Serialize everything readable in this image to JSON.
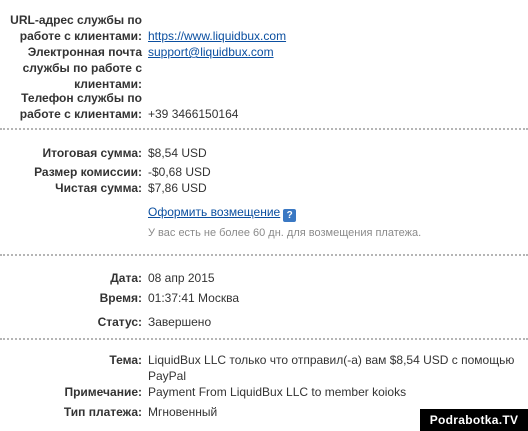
{
  "support": {
    "url_label_1": "URL-адрес службы по",
    "url_label_2": "работе с клиентами:",
    "url_value": "https://www.liquidbux.com",
    "email_label_1": "Электронная почта",
    "email_label_2": "службы по работе с",
    "email_label_3": "клиентами:",
    "email_value": "support@liquidbux.com",
    "phone_label_1": "Телефон службы по",
    "phone_label_2": "работе с клиентами:",
    "phone_value": "+39 3466150164"
  },
  "amounts": {
    "total_label": "Итоговая сумма:",
    "total_value": "$8,54 USD",
    "fee_label": "Размер комиссии:",
    "fee_value": "-$0,68 USD",
    "net_label": "Чистая сумма:",
    "net_value": "$7,86 USD",
    "refund_link": "Оформить возмещение",
    "help_icon_glyph": "?",
    "refund_note": "У вас есть не более 60 дн. для возмещения платежа."
  },
  "datetime": {
    "date_label": "Дата:",
    "date_value": "08 апр 2015",
    "time_label": "Время:",
    "time_value": "01:37:41 Москва",
    "status_label": "Статус:",
    "status_value": "Завершено"
  },
  "details": {
    "subject_label": "Тема:",
    "subject_line_1": "LiquidBux LLC только что отправил(-а) вам $8,54 USD с помощью",
    "subject_line_2": "PayPal",
    "note_label": "Примечание:",
    "note_value": "Payment From LiquidBux LLC to member koioks",
    "type_label": "Тип платежа:",
    "type_value": "Мгновенный"
  },
  "watermark": "Podrabotka.TV",
  "colors": {
    "link": "#0b4fa0",
    "help_icon_bg": "#3a78c3",
    "separator": "#b5b5b5",
    "note_text": "#8a8a8a"
  }
}
